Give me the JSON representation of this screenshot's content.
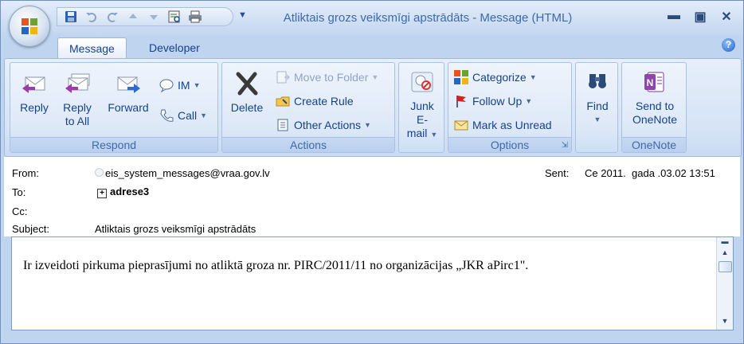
{
  "window": {
    "title": "Atliktais grozs veiksmīgi apstrādāts - Message (HTML)",
    "minimize": "▬",
    "restore": "▣",
    "close": "✕"
  },
  "quick_access": [
    "save-icon",
    "undo-icon",
    "redo-icon",
    "previous-item-icon",
    "next-item-icon",
    "print-preview-icon",
    "print-icon"
  ],
  "tabs": [
    {
      "label": "Message",
      "active": true
    },
    {
      "label": "Developer",
      "active": false
    }
  ],
  "help_label": "?",
  "ribbon": {
    "respond": {
      "label": "Respond",
      "reply": "Reply",
      "reply_all_1": "Reply",
      "reply_all_2": "to All",
      "forward": "Forward",
      "im": "IM",
      "call": "Call"
    },
    "actions": {
      "label": "Actions",
      "delete": "Delete",
      "move_to_folder": "Move to Folder",
      "create_rule": "Create Rule",
      "other_actions": "Other Actions"
    },
    "junk": {
      "line1": "Junk",
      "line2": "E-mail"
    },
    "options": {
      "label": "Options",
      "categorize": "Categorize",
      "follow_up": "Follow Up",
      "mark_unread": "Mark as Unread"
    },
    "find": {
      "label": "Find"
    },
    "onenote": {
      "label": "OneNote",
      "send_1": "Send to",
      "send_2": "OneNote"
    }
  },
  "header": {
    "from_label": "From:",
    "from_value": "eis_system_messages@vraa.gov.lv",
    "to_label": "To:",
    "to_value": "adrese3",
    "cc_label": "Cc:",
    "subject_label": "Subject:",
    "subject_value": "Atliktais grozs veiksmīgi apstrādāts",
    "sent_label": "Sent:",
    "sent_value": "Ce 2011.  gada .03.02 13:51"
  },
  "body": {
    "text": "Ir izveidoti pirkuma pieprasījumi no atliktā groza nr. PIRC/2011/11 no organizācijas „JKR aPirc1\"."
  },
  "colors": {
    "accent": "#15428b",
    "ribbon_bg": "#dde8f7"
  }
}
